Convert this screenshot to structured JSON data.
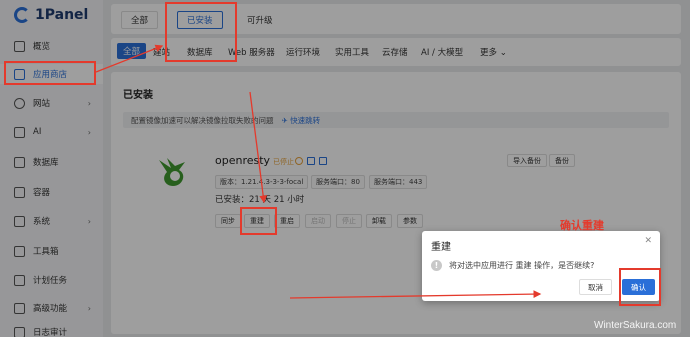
{
  "brand": "1Panel",
  "sidebar": {
    "items": [
      {
        "label": "概览",
        "icon": "home-icon"
      },
      {
        "label": "应用商店",
        "icon": "grid-icon"
      },
      {
        "label": "网站",
        "icon": "globe-icon"
      },
      {
        "label": "AI",
        "icon": "robot-icon"
      },
      {
        "label": "数据库",
        "icon": "database-icon"
      },
      {
        "label": "容器",
        "icon": "container-icon"
      },
      {
        "label": "系统",
        "icon": "system-icon"
      },
      {
        "label": "工具箱",
        "icon": "toolbox-icon"
      },
      {
        "label": "计划任务",
        "icon": "schedule-icon"
      },
      {
        "label": "高级功能",
        "icon": "advanced-icon"
      },
      {
        "label": "日志审计",
        "icon": "log-icon"
      }
    ]
  },
  "top_tabs": [
    "全部",
    "已安装",
    "可升级"
  ],
  "categories": [
    "全部",
    "建站",
    "数据库",
    "Web 服务器",
    "运行环境",
    "实用工具",
    "云存储",
    "AI / 大模型",
    "更多"
  ],
  "installed": {
    "title": "已安装",
    "mirror_notice": "配置镜像加速可以解决镜像拉取失败的问题",
    "mirror_link": "快速跳转",
    "app": {
      "name": "openresty",
      "status": "已停止",
      "version": "版本：1.21.4.3-3-3-focal",
      "http_port": "服务端口：80",
      "https_port": "服务端口：443",
      "installed_time": "已安装：21 天 21 小时",
      "actions": [
        "同步",
        "重建",
        "重启",
        "启动",
        "停止",
        "卸载",
        "参数"
      ],
      "right_buttons": [
        "导入备份",
        "备份"
      ]
    }
  },
  "dialog": {
    "title": "重建",
    "message": "将对选中应用进行 重建 操作，是否继续?",
    "cancel": "取消",
    "confirm": "确认"
  },
  "annotation": {
    "text": "确认重建",
    "color": "#e43a2c"
  },
  "watermark": "WinterSakura.com",
  "colors": {
    "accent": "#2a6fd8",
    "warning": "#e6a23c"
  }
}
